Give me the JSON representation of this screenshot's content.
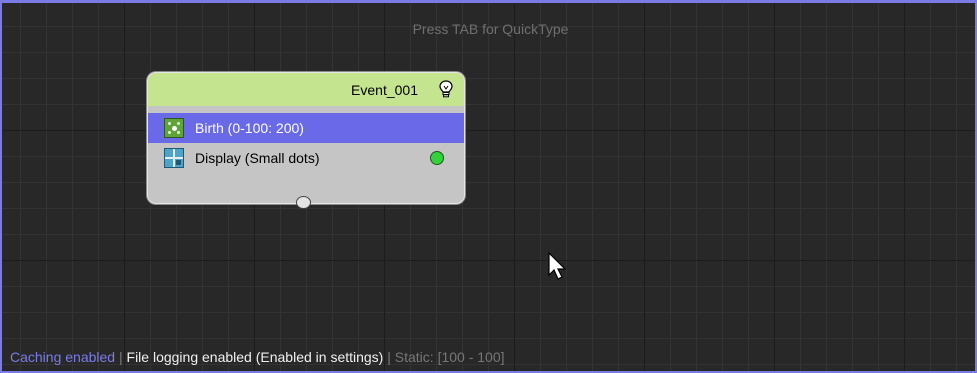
{
  "canvas": {
    "hint": "Press TAB for QuickType"
  },
  "node": {
    "title": "Event_001",
    "header_icon": "lightbulb-icon",
    "rows": [
      {
        "label": "Birth (0-100: 200)",
        "icon": "birth-operator-icon",
        "selected": true
      },
      {
        "label": "Display (Small dots)",
        "icon": "display-operator-icon",
        "selected": false
      }
    ]
  },
  "status_bar": {
    "caching": "Caching enabled",
    "separator1": " | ",
    "file_logging": "File logging enabled (Enabled in settings)",
    "separator2": " | ",
    "static": "Static: [100 - 100]"
  },
  "colors": {
    "header": "#c5e48f",
    "selected_row": "#6a6ae8",
    "node_body": "#c5c5c5",
    "border_accent": "#7b7be8"
  }
}
